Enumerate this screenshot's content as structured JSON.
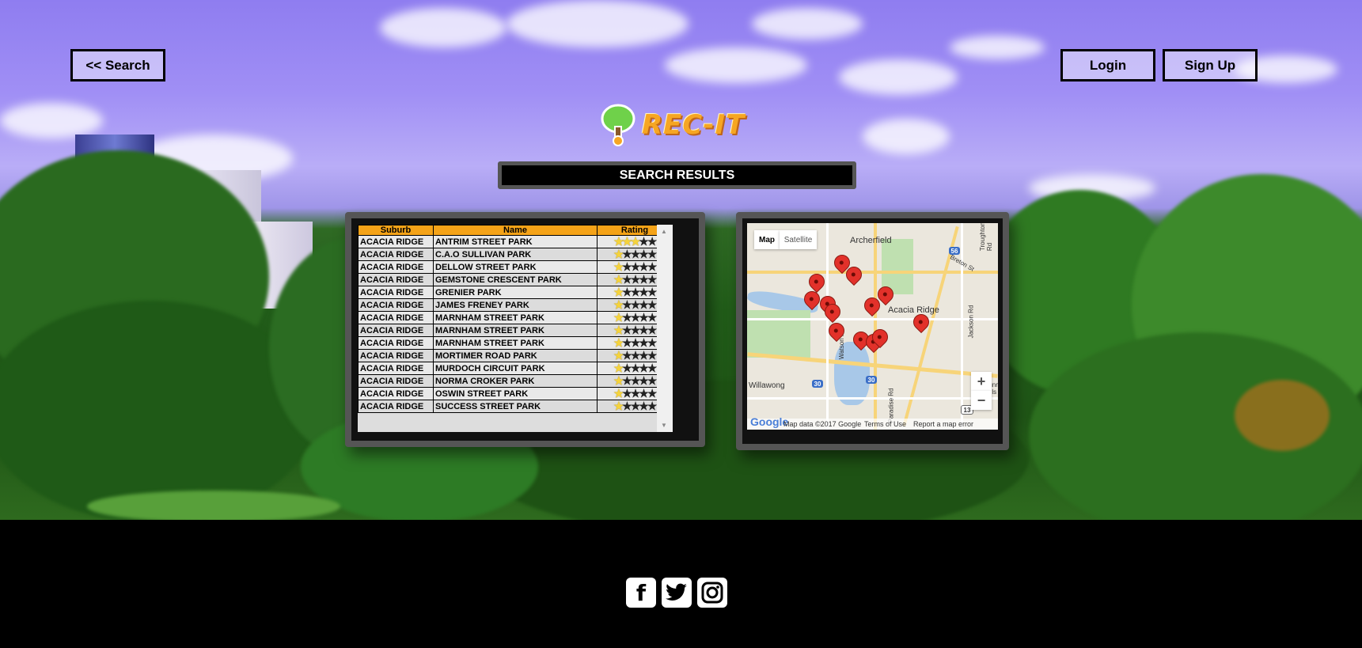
{
  "nav": {
    "back_label": "<< Search",
    "login_label": "Login",
    "signup_label": "Sign Up"
  },
  "logo": {
    "text": "REC-IT"
  },
  "results": {
    "title": "SEARCH RESULTS",
    "columns": [
      "Suburb",
      "Name",
      "Rating"
    ],
    "rows": [
      {
        "suburb": "ACACIA RIDGE",
        "name": "ANTRIM STREET PARK",
        "rating": 3
      },
      {
        "suburb": "ACACIA RIDGE",
        "name": "C.A.O SULLIVAN PARK",
        "rating": 1
      },
      {
        "suburb": "ACACIA RIDGE",
        "name": "DELLOW STREET PARK",
        "rating": 1
      },
      {
        "suburb": "ACACIA RIDGE",
        "name": "GEMSTONE CRESCENT PARK",
        "rating": 1
      },
      {
        "suburb": "ACACIA RIDGE",
        "name": "GRENIER PARK",
        "rating": 1
      },
      {
        "suburb": "ACACIA RIDGE",
        "name": "JAMES FRENEY PARK",
        "rating": 1
      },
      {
        "suburb": "ACACIA RIDGE",
        "name": "MARNHAM STREET PARK",
        "rating": 1
      },
      {
        "suburb": "ACACIA RIDGE",
        "name": "MARNHAM STREET PARK",
        "rating": 1
      },
      {
        "suburb": "ACACIA RIDGE",
        "name": "MARNHAM STREET PARK",
        "rating": 1
      },
      {
        "suburb": "ACACIA RIDGE",
        "name": "MORTIMER ROAD PARK",
        "rating": 1
      },
      {
        "suburb": "ACACIA RIDGE",
        "name": "MURDOCH CIRCUIT PARK",
        "rating": 1
      },
      {
        "suburb": "ACACIA RIDGE",
        "name": "NORMA CROKER PARK",
        "rating": 1
      },
      {
        "suburb": "ACACIA RIDGE",
        "name": "OSWIN STREET PARK",
        "rating": 1
      },
      {
        "suburb": "ACACIA RIDGE",
        "name": "SUCCESS STREET PARK",
        "rating": 1
      }
    ],
    "max_rating": 5
  },
  "map": {
    "tab_map": "Map",
    "tab_satellite": "Satellite",
    "labels": [
      "Archerfield",
      "Acacia Ridge",
      "Willawong",
      "Breton St",
      "Jackson Rd",
      "Watson Rd",
      "Paradise Rd",
      "Troughton Rd",
      "Sunnybank Hills"
    ],
    "shields": [
      "56",
      "30",
      "30",
      "13"
    ],
    "zoom_in": "+",
    "zoom_out": "−",
    "google": "Google",
    "footer_data": "Map data ©2017 Google",
    "footer_terms": "Terms of Use",
    "footer_report": "Report a map error"
  },
  "social": {
    "facebook": "f",
    "twitter": "t",
    "instagram": "ig"
  },
  "colors": {
    "header_orange": "#f5a318",
    "star_on": "#f5d33c",
    "pin_red": "#e2312a"
  }
}
